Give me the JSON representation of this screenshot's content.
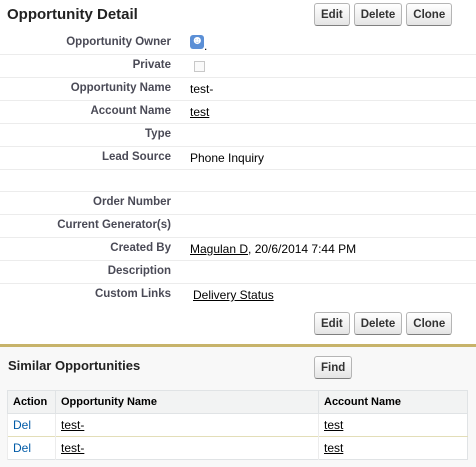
{
  "detail": {
    "title": "Opportunity Detail",
    "buttons": {
      "edit": "Edit",
      "delete": "Delete",
      "clone": "Clone"
    },
    "fields": {
      "owner": {
        "label": "Opportunity Owner",
        "value": "."
      },
      "private": {
        "label": "Private"
      },
      "name": {
        "label": "Opportunity Name",
        "value": "test-"
      },
      "account": {
        "label": "Account Name",
        "value": "test"
      },
      "type": {
        "label": "Type",
        "value": ""
      },
      "lead_source": {
        "label": "Lead Source",
        "value": "Phone Inquiry"
      },
      "order_number": {
        "label": "Order Number",
        "value": ""
      },
      "generators": {
        "label": "Current Generator(s)",
        "value": ""
      },
      "created_by": {
        "label": "Created By",
        "user": "Magulan D",
        "date": ", 20/6/2014 7:44 PM"
      },
      "description": {
        "label": "Description",
        "value": ""
      },
      "custom_links": {
        "label": "Custom Links",
        "value": "Delivery Status"
      }
    }
  },
  "similar": {
    "title": "Similar Opportunities",
    "find_label": "Find",
    "columns": [
      "Action",
      "Opportunity Name",
      "Account Name"
    ],
    "rows": [
      {
        "action": "Del",
        "opportunity": "test-",
        "account": "test"
      },
      {
        "action": "Del",
        "opportunity": "test-",
        "account": "test"
      }
    ]
  },
  "colors": {
    "section_accent": "#c7b36a",
    "action_link": "#015ba7",
    "label_text": "#4a4a56",
    "owner_icon": "#5b8fd6"
  },
  "icons": {
    "owner": "user-avatar-icon",
    "private": "unchecked-checkbox-icon"
  }
}
